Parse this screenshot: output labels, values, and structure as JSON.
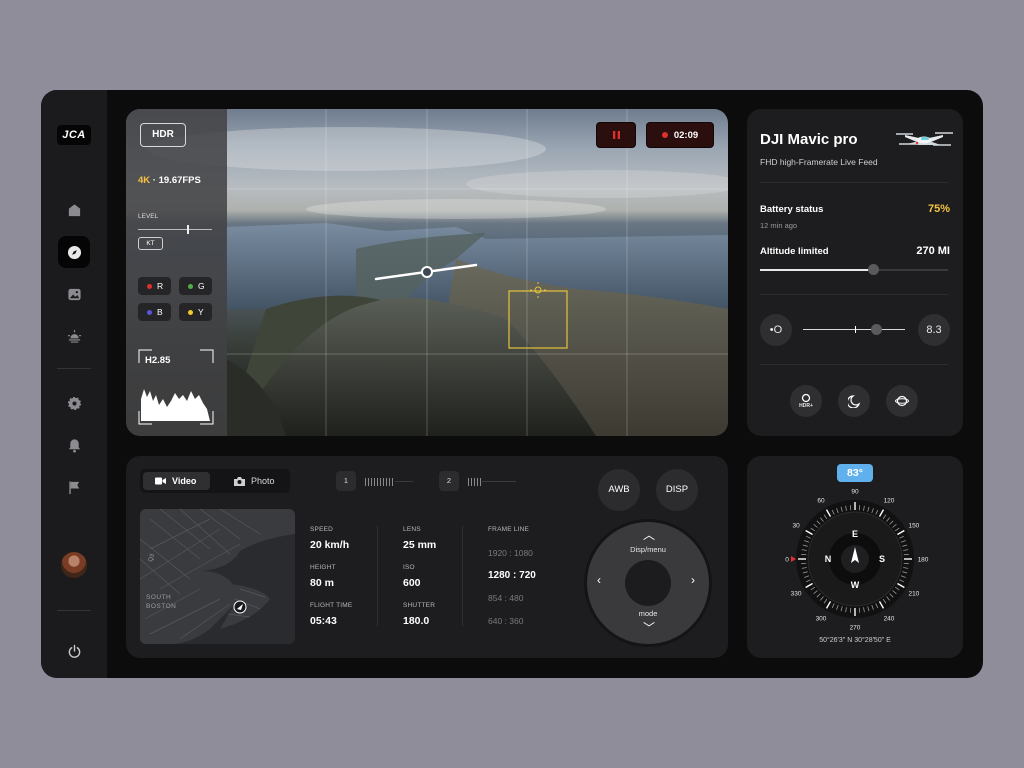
{
  "app": {
    "logo": "JCA"
  },
  "sidebar": {
    "items": [
      {
        "name": "home",
        "active": false
      },
      {
        "name": "compass",
        "active": true
      },
      {
        "name": "gallery",
        "active": false
      },
      {
        "name": "light",
        "active": false
      },
      {
        "name": "settings",
        "active": false
      },
      {
        "name": "notifications",
        "active": false
      },
      {
        "name": "flag",
        "active": false
      }
    ]
  },
  "feed": {
    "hdr_label": "HDR",
    "resolution": "4K",
    "fps": "19.67FPS",
    "level_label": "LEVEL",
    "kt_label": "KT",
    "channels": [
      {
        "label": "R",
        "color": "#e0302c"
      },
      {
        "label": "G",
        "color": "#4fae4a"
      },
      {
        "label": "B",
        "color": "#5757d8"
      },
      {
        "label": "Y",
        "color": "#f2c531"
      }
    ],
    "histogram_label": "H2.85",
    "record_time": "02:09",
    "record_color": "#e0302c"
  },
  "drone": {
    "title": "DJI Mavic pro",
    "subtitle": "FHD high-Framerate Live Feed",
    "battery_label": "Battery status",
    "battery_value": "75%",
    "battery_time": "12 min ago",
    "altitude_label": "Altitude limited",
    "altitude_value": "270 MI",
    "altitude_fraction": 0.6,
    "exposure_value": "8.3",
    "mode_buttons": [
      "hdr-plus",
      "night",
      "planet"
    ],
    "hdr_plus_label": "HDR+"
  },
  "controls": {
    "tabs": [
      {
        "label": "Video",
        "active": true
      },
      {
        "label": "Photo",
        "active": false
      }
    ],
    "counters": [
      "1",
      "2"
    ],
    "map_label_1": "SOUTH",
    "map_label_2": "BOSTON",
    "map_label_3": "Q3",
    "stats": {
      "speed_label": "SPEED",
      "speed_value": "20 km/h",
      "height_label": "HEIGHT",
      "height_value": "80 m",
      "flight_time_label": "FLIGHT TIME",
      "flight_time_value": "05:43",
      "lens_label": "LENS",
      "lens_value": "25 mm",
      "iso_label": "ISO",
      "iso_value": "600",
      "shutter_label": "SHUTTER",
      "shutter_value": "180.0"
    },
    "frame_line_label": "FRAME LINE",
    "frame_lines": [
      {
        "label": "1920 : 1080",
        "active": false
      },
      {
        "label": "1280 : 720",
        "active": true
      },
      {
        "label": "854 : 480",
        "active": false
      },
      {
        "label": "640 : 360",
        "active": false
      }
    ],
    "awb_label": "AWB",
    "disp_label": "DISP",
    "dpad_top_label": "Disp/menu",
    "dpad_bottom_label": "mode"
  },
  "compass": {
    "heading_label": "83°",
    "heading": 83,
    "cardinals": {
      "n": "N",
      "e": "E",
      "s": "S",
      "w": "W"
    },
    "ring_labels": [
      "0",
      "30",
      "60",
      "90",
      "120",
      "150",
      "180",
      "210",
      "240",
      "270",
      "300",
      "330"
    ],
    "coordinates": "50°26'3\" N 30°28'50\" E",
    "accent": "#5fb0ec"
  }
}
